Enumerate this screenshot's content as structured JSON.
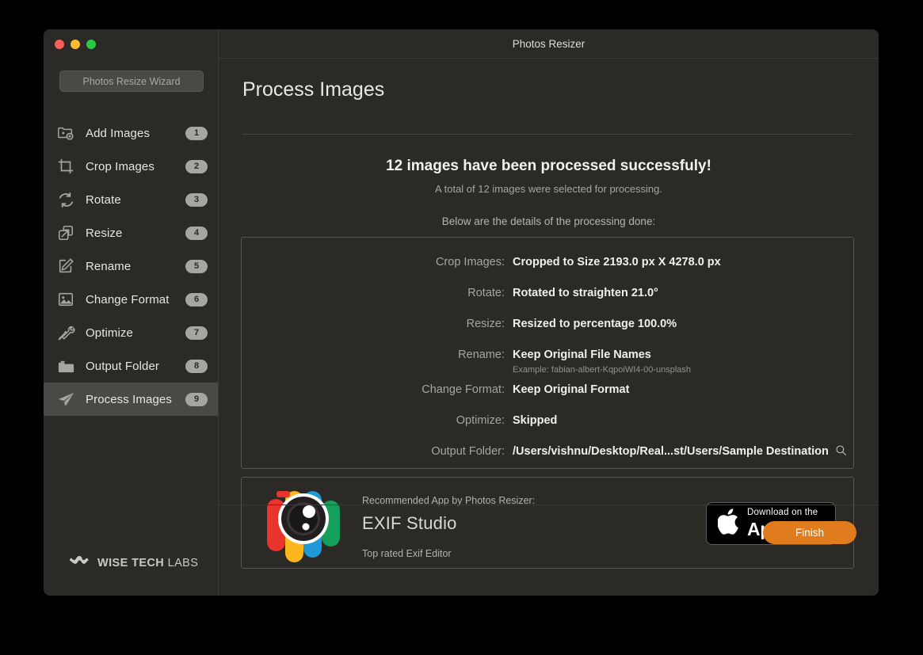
{
  "window": {
    "title": "Photos Resizer",
    "traffic_lights": [
      "close",
      "minimize",
      "zoom"
    ]
  },
  "sidebar": {
    "wizard_button": "Photos Resize Wizard",
    "items": [
      {
        "label": "Add Images",
        "badge": "1",
        "icon": "add-images-icon",
        "active": false
      },
      {
        "label": "Crop Images",
        "badge": "2",
        "icon": "crop-icon",
        "active": false
      },
      {
        "label": "Rotate",
        "badge": "3",
        "icon": "rotate-icon",
        "active": false
      },
      {
        "label": "Resize",
        "badge": "4",
        "icon": "resize-icon",
        "active": false
      },
      {
        "label": "Rename",
        "badge": "5",
        "icon": "rename-icon",
        "active": false
      },
      {
        "label": "Change Format",
        "badge": "6",
        "icon": "image-icon",
        "active": false
      },
      {
        "label": "Optimize",
        "badge": "7",
        "icon": "tools-icon",
        "active": false
      },
      {
        "label": "Output Folder",
        "badge": "8",
        "icon": "folder-icon",
        "active": false
      },
      {
        "label": "Process Images",
        "badge": "9",
        "icon": "paper-plane-icon",
        "active": true
      }
    ],
    "brand": {
      "bold": "WISE TECH",
      "light": "LABS",
      "icon": "wise-tech-labs-logo"
    }
  },
  "main": {
    "page_title": "Process Images",
    "headline": "12 images have been processed successfuly!",
    "subline": "A total of 12 images were selected for processing.",
    "detail_intro": "Below are the details of the processing done:",
    "details": [
      {
        "label": "Crop Images:",
        "value": "Cropped to Size 2193.0 px X 4278.0 px"
      },
      {
        "label": "Rotate:",
        "value": "Rotated to straighten 21.0°"
      },
      {
        "label": "Resize:",
        "value": "Resized to percentage 100.0%"
      },
      {
        "label": "Rename:",
        "value": "Keep Original File Names",
        "example": "Example: fabian-albert-KqpoiWI4-00-unsplash"
      },
      {
        "label": "Change Format:",
        "value": "Keep Original Format"
      },
      {
        "label": "Optimize:",
        "value": "Skipped"
      },
      {
        "label": "Output Folder:",
        "value": "/Users/vishnu/Desktop/Real...st/Users/Sample Destination",
        "trailing_icon": "search-icon"
      }
    ]
  },
  "promo": {
    "kicker": "Recommended App by Photos Resizer:",
    "name": "EXIF Studio",
    "tagline": "Top rated Exif Editor",
    "logo_icon": "exif-studio-logo",
    "appstore": {
      "small_text": "Download on the",
      "big_text": "App Store",
      "icon": "apple-logo-icon"
    }
  },
  "footer": {
    "finish_label": "Finish"
  },
  "colors": {
    "window_bg": "#2b2a27",
    "sidebar_active": "#4a4945",
    "accent_orange": "#e07b1e",
    "badge_gray": "#a6a5a0",
    "logo_red": "#e8342c",
    "logo_yellow": "#fdb71c",
    "logo_blue": "#1f9ad6",
    "logo_green": "#14a05a"
  }
}
